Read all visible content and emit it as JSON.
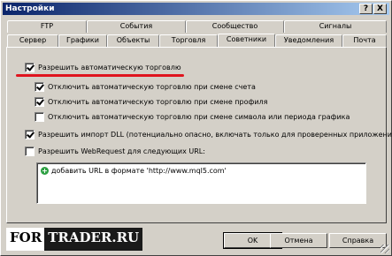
{
  "window": {
    "title": "Настройки",
    "help_glyph": "?",
    "close_glyph": "X"
  },
  "tabs": {
    "top_row": [
      "FTP",
      "События",
      "Сообщество",
      "Сигналы"
    ],
    "bottom_row": [
      "Сервер",
      "Графики",
      "Объекты",
      "Торговля",
      "Советники",
      "Уведомления",
      "Почта"
    ],
    "active": "Советники"
  },
  "options": {
    "allow_auto_trading": {
      "label": "Разрешить автоматическую торговлю",
      "checked": true
    },
    "disable_on_account_change": {
      "label": "Отключить автоматическую торговлю при смене счета",
      "checked": true
    },
    "disable_on_profile_change": {
      "label": "Отключить автоматическую торговлю при смене профиля",
      "checked": true
    },
    "disable_on_symbol_change": {
      "label": "Отключить автоматическую торговлю при смене символа или периода графика",
      "checked": false
    },
    "allow_dll_import": {
      "label": "Разрешить импорт DLL (потенциально опасно, включать только для проверенных приложений)",
      "checked": true
    },
    "allow_webrequest": {
      "label": "Разрешить WebRequest для следующих URL:",
      "checked": false
    }
  },
  "url_list": {
    "add_label": "добавить URL в формате 'http://www.mql5.com'",
    "add_icon": "plus-icon",
    "add_icon_glyph": "+"
  },
  "logo": {
    "part1": "FOR",
    "part2": "TRADER.RU"
  },
  "buttons": {
    "ok": "OK",
    "cancel": "Отмена",
    "help": "Справка"
  },
  "colors": {
    "titlebar_start": "#0a246a",
    "titlebar_end": "#a6caf0",
    "highlight_underline": "#e0141e",
    "dialog_face": "#d4d0c8"
  }
}
